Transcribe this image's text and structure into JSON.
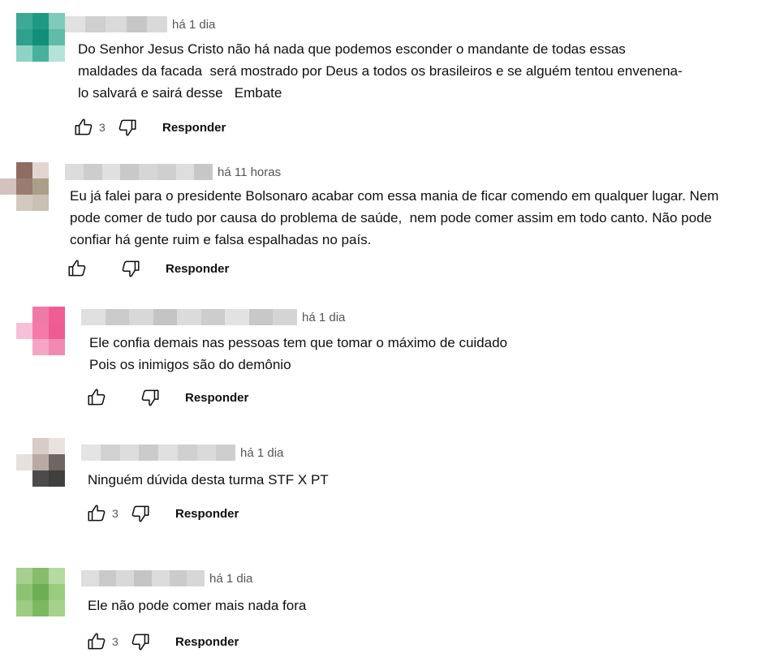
{
  "comments": [
    {
      "time": "há 1 dia",
      "text": "Do Senhor Jesus Cristo não há nada que podemos esconder o mandante de todas essas\nmaldades da facada  será mostrado por Deus a todos os brasileiros e se alguém tentou envenena-\nlo salvará e sairá desse   Embate",
      "likes": "3",
      "reply_label": "Responder",
      "avatar_colors": [
        "#3da996",
        "#1e9a83",
        "#7fcab9",
        "#2fa08d",
        "#138e7a",
        "#5fbca9",
        "#8fd3c4",
        "#48b19e",
        "#b5e3d8"
      ]
    },
    {
      "time": "há 11 horas",
      "text": "Eu já falei para o presidente Bolsonaro acabar com essa mania de ficar comendo em qualquer lugar. Nem\npode comer de tudo por causa do problema de saúde,  nem pode comer assim em todo canto. Não pode\nconfiar há gente ruim e falsa espalhadas no país.",
      "likes": "",
      "reply_label": "Responder",
      "avatar_colors": [
        "#ffffff",
        "#8f6b63",
        "#e3d6d2",
        "#d3c2bd",
        "#9b7c70",
        "#aaa089",
        "#ffffff",
        "#d2c9c0",
        "#c8c1b4"
      ]
    },
    {
      "time": "há 1 dia",
      "text": "Ele confia demais nas pessoas tem que tomar o máximo de cuidado\nPois os inimigos são do demônio",
      "likes": "",
      "reply_label": "Responder",
      "avatar_colors": [
        "#ffffff",
        "#ef7aa6",
        "#ef5e92",
        "#f8c0d6",
        "#f47ba9",
        "#ee5b93",
        "#ffffff",
        "#f6a6c5",
        "#f08ab3"
      ]
    },
    {
      "time": "há 1 dia",
      "text": "Ninguém dúvida desta turma STF X PT",
      "likes": "3",
      "reply_label": "Responder",
      "avatar_colors": [
        "#ffffff",
        "#d8ccc7",
        "#e9e2df",
        "#e4e1de",
        "#b9aaa3",
        "#6e6662",
        "#ffffff",
        "#4b4b4b",
        "#3f3f3f"
      ]
    },
    {
      "time": "há 1 dia",
      "text": "Ele não pode comer mais nada fora",
      "likes": "3",
      "reply_label": "Responder",
      "avatar_colors": [
        "#a7cf90",
        "#86bd6a",
        "#b6d9a2",
        "#8cc371",
        "#6eae52",
        "#9bcb7f",
        "#9ccd83",
        "#7cb862",
        "#a5d18d"
      ]
    }
  ],
  "name_blur_colors": [
    [
      "#e1e1e1",
      "#cfcfcf",
      "#dadada",
      "#c6c6c6",
      "#d9d9d9"
    ],
    [
      "#dcdcdc",
      "#cdcdcd",
      "#e0e0e0",
      "#c9c9c9",
      "#d6d6d6",
      "#cfcfcf",
      "#dedede",
      "#c7c7c7"
    ],
    [
      "#e0e0e0",
      "#cbcbcb",
      "#d8d8d8",
      "#c4c4c4",
      "#dbdbdb",
      "#cdcdcd",
      "#e2e2e2",
      "#c8c8c8",
      "#d4d4d4"
    ],
    [
      "#e4e4e4",
      "#d2d2d2",
      "#dddddd",
      "#cbcbcb",
      "#e0e0e0",
      "#d0d0d0",
      "#dadada",
      "#cecece"
    ],
    [
      "#dedede",
      "#cacaca",
      "#d9d9d9",
      "#c5c5c5",
      "#dcdcdc",
      "#cbcbcb",
      "#d7d7d7"
    ]
  ]
}
